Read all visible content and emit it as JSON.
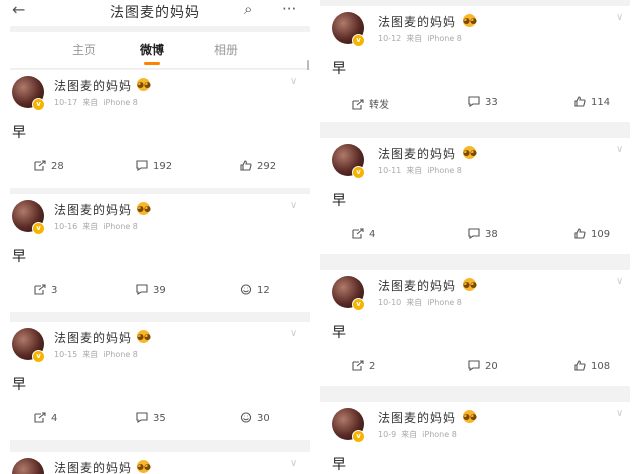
{
  "left": {
    "header": {
      "title": "法图麦的妈妈",
      "back_icon": "←",
      "search_icon": "⌕",
      "more_icon": "···"
    },
    "tabs": [
      "主页",
      "微博",
      "相册"
    ],
    "active_tab": 1,
    "posts": [
      {
        "name": "法图麦的妈妈",
        "date": "10-17",
        "via": "来自",
        "device": "iPhone 8",
        "text": "早",
        "reposts": "28",
        "comments": "192",
        "likes": "292",
        "third": "likes"
      },
      {
        "name": "法图麦的妈妈",
        "date": "10-16",
        "via": "来自",
        "device": "iPhone 8",
        "text": "早",
        "reposts": "3",
        "comments": "39",
        "likes": "12",
        "third": "smile"
      },
      {
        "name": "法图麦的妈妈",
        "date": "10-15",
        "via": "来自",
        "device": "iPhone 8",
        "text": "早",
        "reposts": "4",
        "comments": "35",
        "likes": "30",
        "third": "smile"
      },
      {
        "name": "法图麦的妈妈",
        "date": "",
        "via": "",
        "device": "",
        "text": "",
        "reposts": "",
        "comments": "",
        "likes": "",
        "third": "none"
      }
    ]
  },
  "right": {
    "posts": [
      {
        "name": "法图麦的妈妈",
        "date": "10-12",
        "via": "来自",
        "device": "iPhone 8",
        "text": "早",
        "reposts": "转发",
        "comments": "33",
        "likes": "114"
      },
      {
        "name": "法图麦的妈妈",
        "date": "10-11",
        "via": "来自",
        "device": "iPhone 8",
        "text": "早",
        "reposts": "4",
        "comments": "38",
        "likes": "109"
      },
      {
        "name": "法图麦的妈妈",
        "date": "10-10",
        "via": "来自",
        "device": "iPhone 8",
        "text": "早",
        "reposts": "2",
        "comments": "20",
        "likes": "108"
      },
      {
        "name": "法图麦的妈妈",
        "date": "10-9",
        "via": "来自",
        "device": "iPhone 8",
        "text": "早",
        "reposts": "",
        "comments": "",
        "likes": ""
      }
    ]
  },
  "colors": {
    "accent": "#ff8200",
    "badge": "#f5b400",
    "background": "#f2f2f2"
  },
  "emoji_glyph": "◕◕",
  "verified_glyph": "v",
  "chevron_glyph": "∨"
}
